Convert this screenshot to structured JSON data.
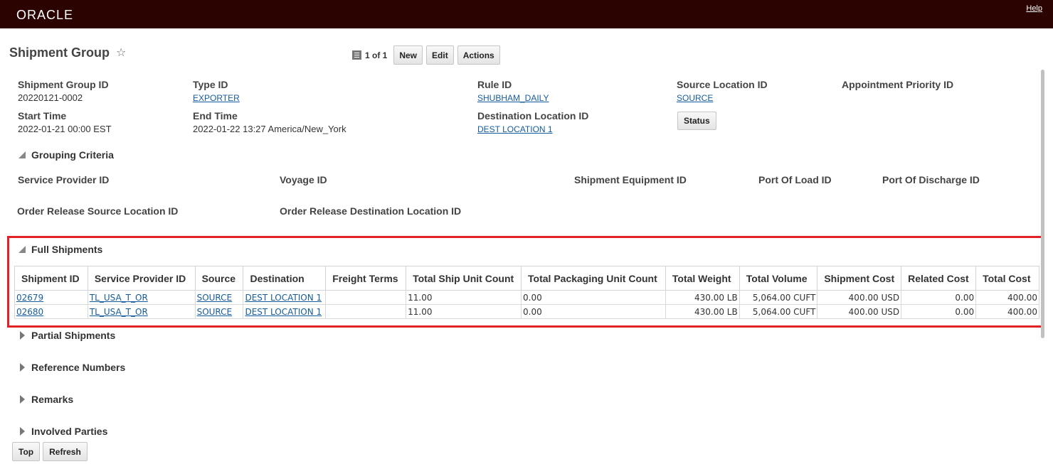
{
  "header": {
    "logo": "ORACLE",
    "help": "Help"
  },
  "page": {
    "title": "Shipment Group",
    "pager": "1 of 1",
    "buttons": {
      "new": "New",
      "edit": "Edit",
      "actions": "Actions"
    }
  },
  "fields": {
    "shipment_group_id": {
      "label": "Shipment Group ID",
      "value": "20220121-0002"
    },
    "type_id": {
      "label": "Type ID",
      "value": "EXPORTER"
    },
    "rule_id": {
      "label": "Rule ID",
      "value": "SHUBHAM_DAILY"
    },
    "source_location_id": {
      "label": "Source Location ID",
      "value": "SOURCE"
    },
    "appointment_priority_id": {
      "label": "Appointment Priority ID",
      "value": ""
    },
    "start_time": {
      "label": "Start Time",
      "value": "2022-01-21 00:00 EST"
    },
    "end_time": {
      "label": "End Time",
      "value": "2022-01-22 13:27 America/New_York"
    },
    "destination_location_id": {
      "label": "Destination Location ID",
      "value": "DEST LOCATION 1"
    },
    "status_button": "Status"
  },
  "grouping_criteria": {
    "title": "Grouping Criteria",
    "labels": {
      "service_provider_id": "Service Provider ID",
      "voyage_id": "Voyage ID",
      "shipment_equipment_id": "Shipment Equipment ID",
      "port_of_load_id": "Port Of Load ID",
      "port_of_discharge_id": "Port Of Discharge ID",
      "order_release_source_location_id": "Order Release Source Location ID",
      "order_release_destination_location_id": "Order Release Destination Location ID"
    }
  },
  "full_shipments": {
    "title": "Full Shipments",
    "columns": [
      "Shipment ID",
      "Service Provider ID",
      "Source",
      "Destination",
      "Freight Terms",
      "Total Ship Unit Count",
      "Total Packaging Unit Count",
      "Total Weight",
      "Total Volume",
      "Shipment Cost",
      "Related Cost",
      "Total Cost"
    ],
    "rows": [
      {
        "shipment_id": "02679",
        "service_provider_id": "TL_USA_T_OR",
        "source": "SOURCE",
        "destination": "DEST LOCATION 1",
        "freight_terms": "",
        "total_ship_unit_count": "11.00",
        "total_packaging_unit_count": "0.00",
        "total_weight": "430.00 LB",
        "total_volume": "5,064.00 CUFT",
        "shipment_cost": "400.00 USD",
        "related_cost": "0.00",
        "total_cost": "400.00"
      },
      {
        "shipment_id": "02680",
        "service_provider_id": "TL_USA_T_OR",
        "source": "SOURCE",
        "destination": "DEST LOCATION 1",
        "freight_terms": "",
        "total_ship_unit_count": "11.00",
        "total_packaging_unit_count": "0.00",
        "total_weight": "430.00 LB",
        "total_volume": "5,064.00 CUFT",
        "shipment_cost": "400.00 USD",
        "related_cost": "0.00",
        "total_cost": "400.00"
      }
    ]
  },
  "sections": {
    "partial_shipments": "Partial Shipments",
    "reference_numbers": "Reference Numbers",
    "remarks": "Remarks",
    "involved_parties": "Involved Parties"
  },
  "footer_buttons": {
    "top": "Top",
    "refresh": "Refresh"
  },
  "colors": {
    "topbar": "#2b0301",
    "highlight": "#e02127",
    "link": "#145c9e"
  }
}
